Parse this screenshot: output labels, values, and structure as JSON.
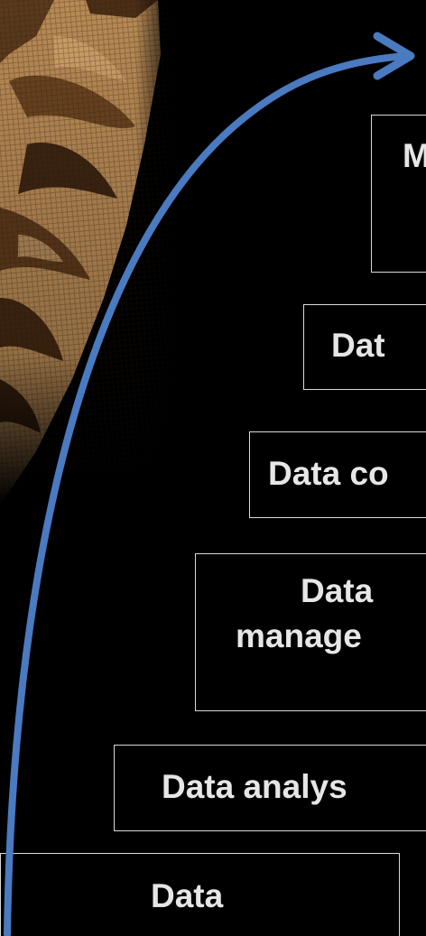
{
  "photo": {
    "icon": "snakeskin-photo"
  },
  "arrow": {
    "color": "#4a7ac0",
    "icon": "curved-arrow-icon"
  },
  "boxes": [
    {
      "lines": [
        "M"
      ]
    },
    {
      "lines": [
        "Dat"
      ]
    },
    {
      "lines": [
        "Data co"
      ]
    },
    {
      "lines": [
        "Data",
        "manage"
      ]
    },
    {
      "lines": [
        "Data analys"
      ]
    },
    {
      "lines": [
        "Data"
      ]
    }
  ]
}
